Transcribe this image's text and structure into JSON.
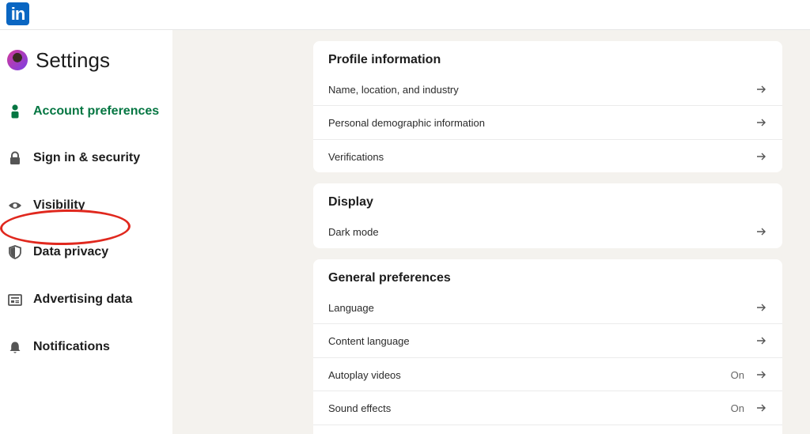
{
  "header": {
    "logo_text": "in"
  },
  "sidebar": {
    "title": "Settings",
    "items": [
      {
        "label": "Account preferences",
        "icon": "person-icon",
        "active": true
      },
      {
        "label": "Sign in & security",
        "icon": "lock-icon"
      },
      {
        "label": "Visibility",
        "icon": "eye-icon"
      },
      {
        "label": "Data privacy",
        "icon": "shield-icon"
      },
      {
        "label": "Advertising data",
        "icon": "newspaper-icon"
      },
      {
        "label": "Notifications",
        "icon": "bell-icon"
      }
    ]
  },
  "colors": {
    "brand": "#0a66c2",
    "active": "#057642",
    "annotation": "#e0281e",
    "background": "#f4f2ee"
  },
  "sections": {
    "profile": {
      "title": "Profile information",
      "rows": [
        {
          "label": "Name, location, and industry"
        },
        {
          "label": "Personal demographic information"
        },
        {
          "label": "Verifications"
        }
      ]
    },
    "display": {
      "title": "Display",
      "rows": [
        {
          "label": "Dark mode"
        }
      ]
    },
    "general": {
      "title": "General preferences",
      "rows": [
        {
          "label": "Language"
        },
        {
          "label": "Content language"
        },
        {
          "label": "Autoplay videos",
          "value": "On"
        },
        {
          "label": "Sound effects",
          "value": "On"
        }
      ]
    }
  }
}
